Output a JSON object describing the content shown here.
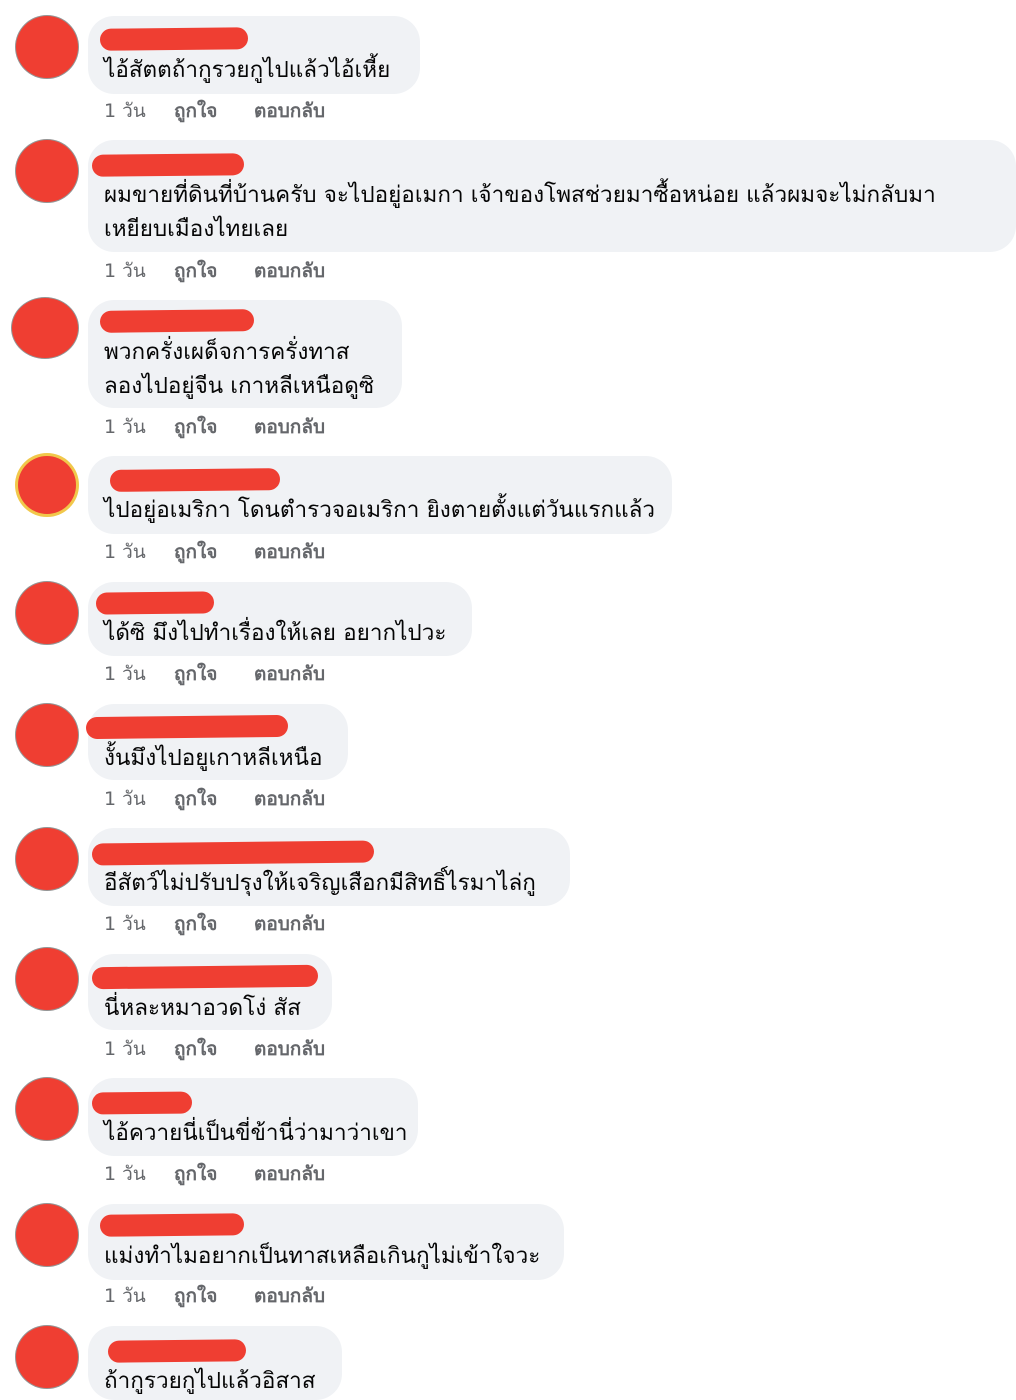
{
  "comments": [
    {
      "text": "ไอ้สัตตถ้ากูรวยกูไปแล้วไอ้เหี้ย",
      "time": "1 วัน",
      "like": "ถูกใจ",
      "reply": "ตอบกลับ"
    },
    {
      "text": "ผมขายที่ดินที่บ้านครับ จะไปอยู่อเมกา  เจ้าของโพสช่วยมาซื้อหน่อย แล้วผมจะไม่กลับมา",
      "text2": "เหยียบเมืองไทยเลย",
      "time": "1 วัน",
      "like": "ถูกใจ",
      "reply": "ตอบกลับ"
    },
    {
      "text": "พวกครั่งเผด็จการครั่งทาส",
      "text2": "ลองไปอยู่จีน เกาหลีเหนือดูซิ",
      "time": "1 วัน",
      "like": "ถูกใจ",
      "reply": "ตอบกลับ"
    },
    {
      "text": "ไปอยู่อเมริกา โดนตำรวจอเมริกา ยิงตายตั้งแต่วันแรกแล้ว",
      "time": "1 วัน",
      "like": "ถูกใจ",
      "reply": "ตอบกลับ"
    },
    {
      "text": "ได้ซิ มึงไปทำเรื่องให้เลย อยากไปวะ",
      "time": "1 วัน",
      "like": "ถูกใจ",
      "reply": "ตอบกลับ"
    },
    {
      "text": "งั้นมึงไปอยูเกาหลีเหนือ",
      "time": "1 วัน",
      "like": "ถูกใจ",
      "reply": "ตอบกลับ"
    },
    {
      "text": "อีสัตว์ไม่ปรับปรุงให้เจริญเสือกมีสิทธิ์ไรมาไล่กู",
      "time": "1 วัน",
      "like": "ถูกใจ",
      "reply": "ตอบกลับ"
    },
    {
      "text": "นี่หละหมาอวดโง่ สัส",
      "time": "1 วัน",
      "like": "ถูกใจ",
      "reply": "ตอบกลับ"
    },
    {
      "text": "ไอ้ควายนี่เป็นขี่ข้านี่ว่ามาว่าเขา",
      "time": "1 วัน",
      "like": "ถูกใจ",
      "reply": "ตอบกลับ"
    },
    {
      "text": "แม่งทำไมอยากเป็นทาสเหลือเกินกูไม่เข้าใจวะ",
      "time": "1 วัน",
      "like": "ถูกใจ",
      "reply": "ตอบกลับ"
    },
    {
      "text": "ถ้ากูรวยกูไปแล้วอิสาส"
    }
  ],
  "colors": {
    "bubble": "#f0f2f5",
    "redaction": "#ef3e32",
    "meta_text": "#65676b",
    "avatar_ring_highlight": "#f1c84b"
  }
}
